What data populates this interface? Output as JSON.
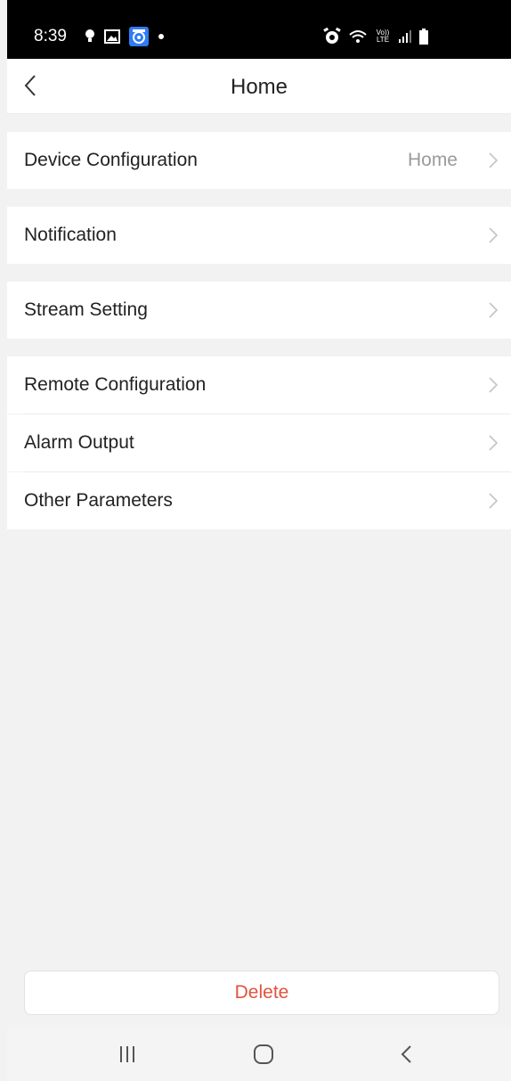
{
  "status_bar": {
    "time": "8:39",
    "network_label_top": "Vo))",
    "network_label_bottom": "LTE",
    "icons": [
      "bulb-icon",
      "image-icon",
      "app-icon",
      "dot-icon",
      "alarm-icon",
      "wifi-icon",
      "signal-icon",
      "battery-icon"
    ],
    "app_icon_color": "#2f7cf6"
  },
  "header": {
    "title": "Home"
  },
  "settings": {
    "device_configuration": {
      "label": "Device Configuration",
      "value": "Home"
    },
    "notification": {
      "label": "Notification"
    },
    "stream_setting": {
      "label": "Stream Setting"
    },
    "remote_configuration": {
      "label": "Remote Configuration"
    },
    "alarm_output": {
      "label": "Alarm Output"
    },
    "other_parameters": {
      "label": "Other Parameters"
    }
  },
  "actions": {
    "delete_label": "Delete",
    "delete_color": "#e0533f"
  },
  "nav_bar": {
    "icons": [
      "recent-apps-icon",
      "home-icon",
      "back-icon"
    ]
  }
}
